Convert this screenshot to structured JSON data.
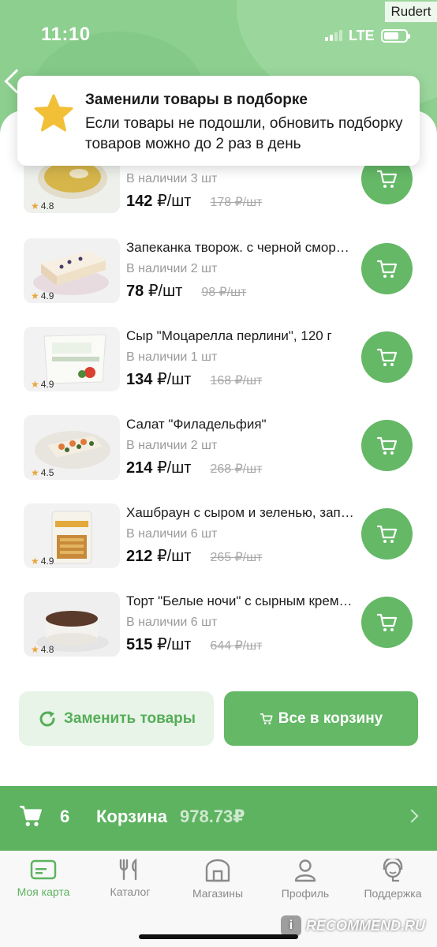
{
  "status_bar": {
    "time": "11:10",
    "network": "LTE"
  },
  "watermark_user": "Rudert",
  "toast": {
    "title": "Заменили товары в подборке",
    "body": "Если товары не подошли, обновить подборку товаров можно до 2 раз в день"
  },
  "products": [
    {
      "name": "",
      "stock": "В наличии 3 шт",
      "price": "142",
      "unit": "₽/шт",
      "old_price": "178 ₽/шт",
      "rating": "4.8"
    },
    {
      "name": "Запеканка творож. с черной смородиной",
      "stock": "В наличии 2 шт",
      "price": "78",
      "unit": "₽/шт",
      "old_price": "98 ₽/шт",
      "rating": "4.9"
    },
    {
      "name": "Сыр \"Моцарелла перлини\", 120 г",
      "stock": "В наличии 1 шт",
      "price": "134",
      "unit": "₽/шт",
      "old_price": "168 ₽/шт",
      "rating": "4.9"
    },
    {
      "name": "Салат \"Филадельфия\"",
      "stock": "В наличии 2 шт",
      "price": "214",
      "unit": "₽/шт",
      "old_price": "268 ₽/шт",
      "rating": "4.5"
    },
    {
      "name": "Хашбраун с сыром и зеленью, запечённый",
      "stock": "В наличии 6 шт",
      "price": "212",
      "unit": "₽/шт",
      "old_price": "265 ₽/шт",
      "rating": "4.9"
    },
    {
      "name": "Торт \"Белые ночи\" с сырным кремом",
      "stock": "В наличии 6 шт",
      "price": "515",
      "unit": "₽/шт",
      "old_price": "644 ₽/шт",
      "rating": "4.8"
    }
  ],
  "actions": {
    "replace_label": "Заменить товары",
    "all_to_cart_label": "Все в корзину"
  },
  "cart_bar": {
    "count": "6",
    "label": "Корзина",
    "total": "978.73₽"
  },
  "tabs": [
    {
      "label": "Моя карта",
      "icon": "card-icon",
      "active": true
    },
    {
      "label": "Каталог",
      "icon": "cutlery-icon",
      "active": false
    },
    {
      "label": "Магазины",
      "icon": "store-icon",
      "active": false
    },
    {
      "label": "Профиль",
      "icon": "profile-icon",
      "active": false
    },
    {
      "label": "Поддержка",
      "icon": "support-icon",
      "active": false
    }
  ],
  "site_watermark": "RECOMMEND.RU",
  "colors": {
    "brand_green": "#64b866",
    "header_green": "#8ccf8e",
    "light_green": "#e7f4e7",
    "muted_text": "#9a9a9a",
    "star": "#f2c037"
  }
}
